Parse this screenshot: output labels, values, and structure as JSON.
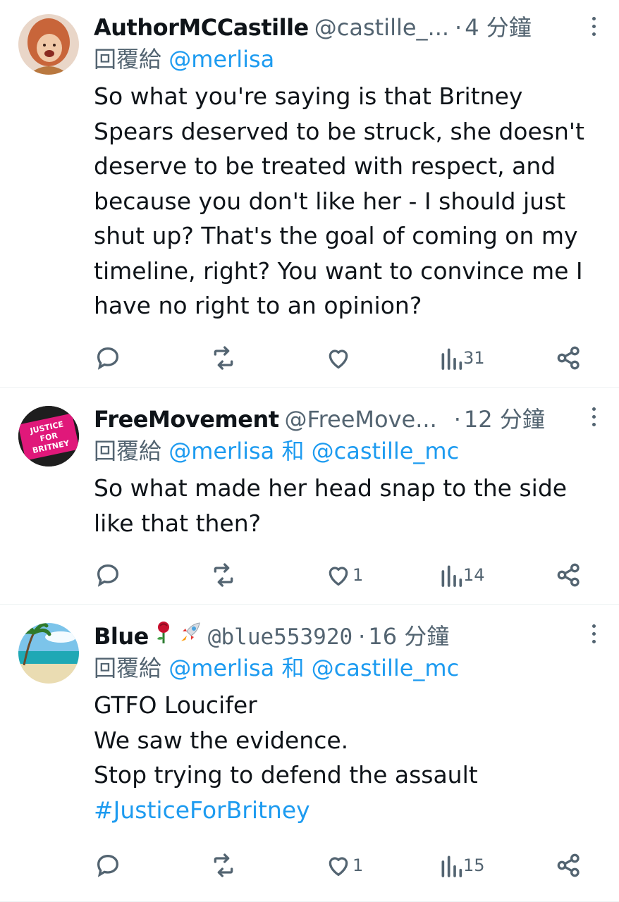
{
  "tweets": [
    {
      "name": "AuthorMCCastille",
      "handle": "@castille_...",
      "dot": "·",
      "time": "4 分鐘",
      "reply_prefix": "回覆給",
      "reply_to": "@merlisa",
      "reply_and": "",
      "reply_to2": "",
      "text": "So what you're saying is that Britney Spears deserved to be struck, she doesn't deserve to be treated with respect, and because you don't like her - I should just shut up? That's the goal of coming on my timeline, right? You want to convince me I have no right to an opinion?",
      "hashtag": "",
      "likes": "",
      "views": "31",
      "avatar_icon": "red-haired-person-avatar",
      "avatar_color": "#c8653a"
    },
    {
      "name": "FreeMovement",
      "handle": "@FreeMove...",
      "dot": "·",
      "time": "12 分鐘",
      "reply_prefix": "回覆給",
      "reply_to": "@merlisa",
      "reply_and": "和",
      "reply_to2": "@castille_mc",
      "text": "So what made her head snap to the side like that then?",
      "hashtag": "",
      "likes": "1",
      "views": "14",
      "avatar_icon": "justice-for-britney-sign-avatar",
      "avatar_text": [
        "JUSTICE",
        "FOR",
        "BRITNEY"
      ],
      "avatar_color": "#e0187a"
    },
    {
      "name": "Blue",
      "emojis": [
        "rose-emoji",
        "rocket-emoji"
      ],
      "handle": "@blue553920",
      "dot": "·",
      "time": "16 分鐘",
      "reply_prefix": "回覆給",
      "reply_to": "@merlisa",
      "reply_and": "和",
      "reply_to2": "@castille_mc",
      "text": "GTFO Loucifer\nWe saw the evidence.\nStop trying to defend the assault",
      "hashtag": "#JusticeForBritney",
      "likes": "1",
      "views": "15",
      "avatar_icon": "beach-palm-avatar",
      "avatar_color": "#5fb7d8"
    }
  ],
  "icons": {
    "reply": "reply-icon",
    "retweet": "retweet-icon",
    "like": "heart-icon",
    "views": "views-bar-chart-icon",
    "share": "share-icon",
    "more": "more-vertical-icon"
  },
  "colors": {
    "link": "#1d9bf0",
    "secondary": "#536471",
    "text": "#0f1419"
  }
}
